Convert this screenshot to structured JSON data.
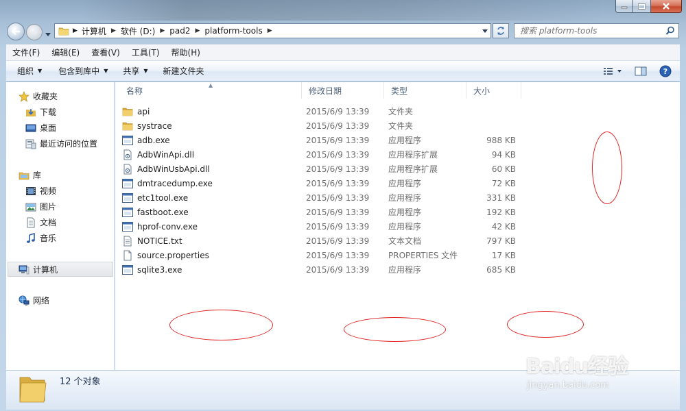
{
  "address": {
    "crumbs": [
      "计算机",
      "软件 (D:)",
      "pad2",
      "platform-tools"
    ]
  },
  "search": {
    "placeholder": "搜索 platform-tools"
  },
  "menu": [
    "文件(F)",
    "编辑(E)",
    "查看(V)",
    "工具(T)",
    "帮助(H)"
  ],
  "commands": {
    "organize": "组织",
    "include_library": "包含到库中",
    "share": "共享",
    "new_folder": "新建文件夹"
  },
  "nav": {
    "favorites": "收藏夹",
    "downloads": "下载",
    "desktop": "桌面",
    "recent": "最近访问的位置",
    "libraries": "库",
    "videos": "视频",
    "pictures": "图片",
    "documents": "文档",
    "music": "音乐",
    "computer": "计算机",
    "network": "网络"
  },
  "columns": {
    "name": "名称",
    "date": "修改日期",
    "type": "类型",
    "size": "大小"
  },
  "files": [
    {
      "name": "api",
      "date": "2015/6/9 13:39",
      "type": "文件夹",
      "size": "",
      "icon": "folder"
    },
    {
      "name": "systrace",
      "date": "2015/6/9 13:39",
      "type": "文件夹",
      "size": "",
      "icon": "folder"
    },
    {
      "name": "adb.exe",
      "date": "2015/6/9 13:39",
      "type": "应用程序",
      "size": "988 KB",
      "icon": "exe"
    },
    {
      "name": "AdbWinApi.dll",
      "date": "2015/6/9 13:39",
      "type": "应用程序扩展",
      "size": "94 KB",
      "icon": "dll"
    },
    {
      "name": "AdbWinUsbApi.dll",
      "date": "2015/6/9 13:39",
      "type": "应用程序扩展",
      "size": "60 KB",
      "icon": "dll"
    },
    {
      "name": "dmtracedump.exe",
      "date": "2015/6/9 13:39",
      "type": "应用程序",
      "size": "72 KB",
      "icon": "exe"
    },
    {
      "name": "etc1tool.exe",
      "date": "2015/6/9 13:39",
      "type": "应用程序",
      "size": "331 KB",
      "icon": "exe"
    },
    {
      "name": "fastboot.exe",
      "date": "2015/6/9 13:39",
      "type": "应用程序",
      "size": "192 KB",
      "icon": "exe"
    },
    {
      "name": "hprof-conv.exe",
      "date": "2015/6/9 13:39",
      "type": "应用程序",
      "size": "42 KB",
      "icon": "exe"
    },
    {
      "name": "NOTICE.txt",
      "date": "2015/6/9 13:39",
      "type": "文本文档",
      "size": "797 KB",
      "icon": "txt"
    },
    {
      "name": "source.properties",
      "date": "2015/6/9 13:39",
      "type": "PROPERTIES 文件",
      "size": "17 KB",
      "icon": "file"
    },
    {
      "name": "sqlite3.exe",
      "date": "2015/6/9 13:39",
      "type": "应用程序",
      "size": "685 KB",
      "icon": "exe"
    }
  ],
  "status": {
    "item_count": "12 个对象"
  },
  "watermark": {
    "brand": "Baidu经验",
    "url": "jingyan.baidu.com"
  },
  "colors": {
    "annotation": "#e02020",
    "accent": "#3a6ea5"
  }
}
